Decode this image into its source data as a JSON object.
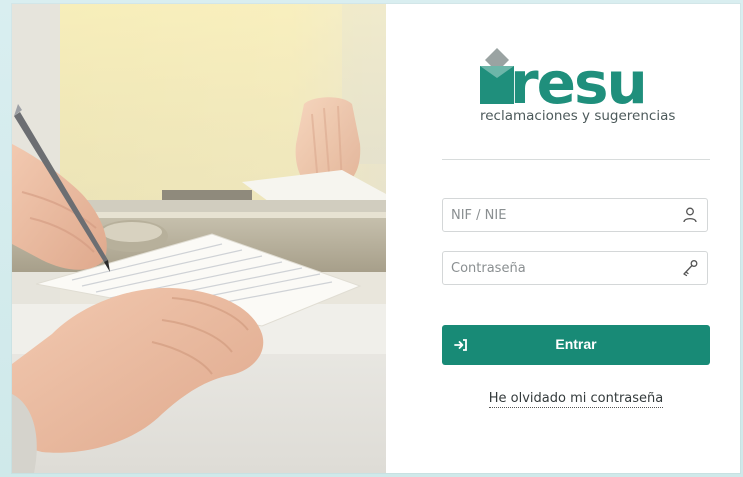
{
  "brand": {
    "logo_word": "resu",
    "tagline": "reclamaciones y sugerencias",
    "color": "#1f8f7c",
    "accent_shape_color": "#9aa3a2"
  },
  "photo": {
    "description_icon": "service-counter-hands-signing-form"
  },
  "form": {
    "nif_placeholder": "NIF / NIE",
    "nif_value": "",
    "nif_icon": "user-icon",
    "password_placeholder": "Contraseña",
    "password_value": "",
    "password_icon": "key-icon",
    "submit_label": "Entrar",
    "submit_icon": "sign-in-icon",
    "submit_color": "#188a76",
    "forgot_link": "He olvidado mi contraseña"
  }
}
